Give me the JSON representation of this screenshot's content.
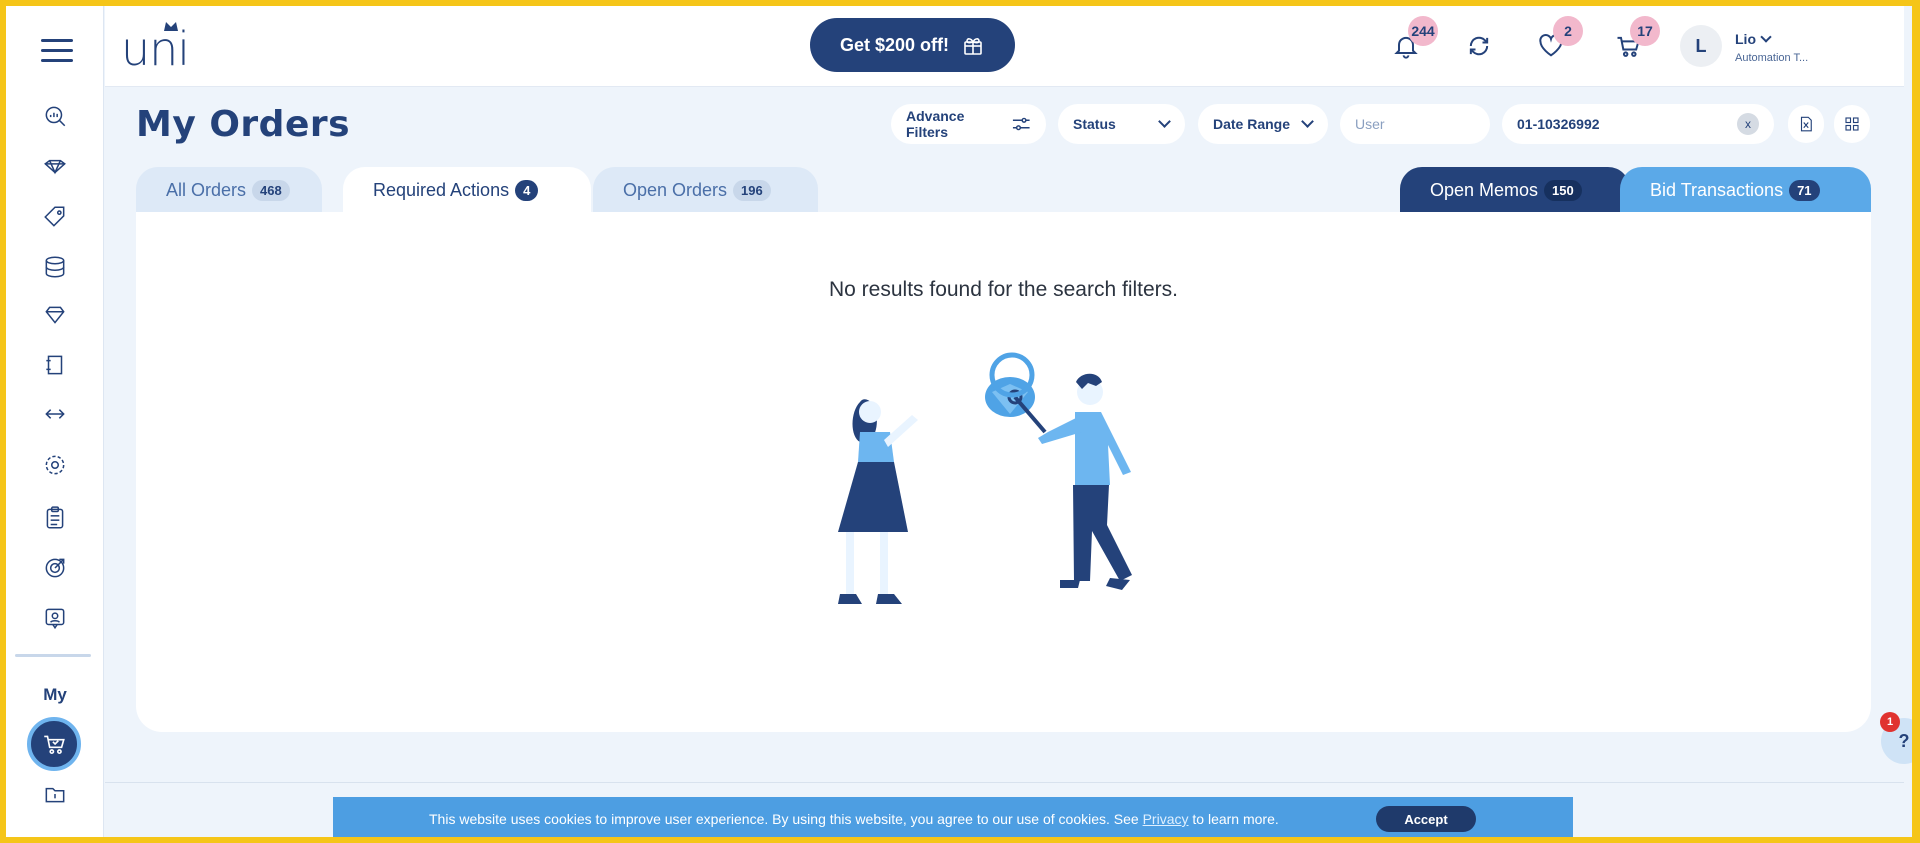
{
  "header": {
    "logo_text": "uni",
    "promo_label": "Get $200 off!",
    "notifications_count": "244",
    "wishlist_count": "2",
    "cart_count": "17",
    "avatar_initial": "L",
    "user_name": "Lio",
    "user_role": "Automation T..."
  },
  "sidebar": {
    "section_label": "My",
    "icons": [
      "analytics-icon",
      "handshake-diamond-icon",
      "tag-icon",
      "database-icon",
      "diamond-icon",
      "memo-icon",
      "transfer-icon",
      "settings-icon",
      "clipboard-icon",
      "target-icon",
      "badge-icon",
      "cart-icon",
      "folder-icon"
    ]
  },
  "page": {
    "title": "My Orders",
    "advance_filters_label": "Advance Filters",
    "status_label": "Status",
    "date_range_label": "Date Range",
    "user_placeholder": "User",
    "search_value": "01-10326992",
    "clear_label": "x"
  },
  "tabs": {
    "all_orders": {
      "label": "All Orders",
      "count": "468"
    },
    "required_actions": {
      "label": "Required Actions",
      "count": "4"
    },
    "open_orders": {
      "label": "Open Orders",
      "count": "196"
    },
    "open_memos": {
      "label": "Open Memos",
      "count": "150"
    },
    "bid_transactions": {
      "label": "Bid Transactions",
      "count": "71"
    }
  },
  "content": {
    "empty_message": "No results found for the search filters."
  },
  "help": {
    "label": "?",
    "badge": "1"
  },
  "cookie": {
    "text_before": "This website uses cookies to improve user experience. By using this website, you agree to our use of cookies. See ",
    "link": "Privacy",
    "text_after": " to learn more.",
    "accept_label": "Accept"
  },
  "colors": {
    "brand": "#24427a",
    "accent": "#5ba9e8",
    "badge": "#f2b8cc",
    "frame": "#f5c518"
  }
}
